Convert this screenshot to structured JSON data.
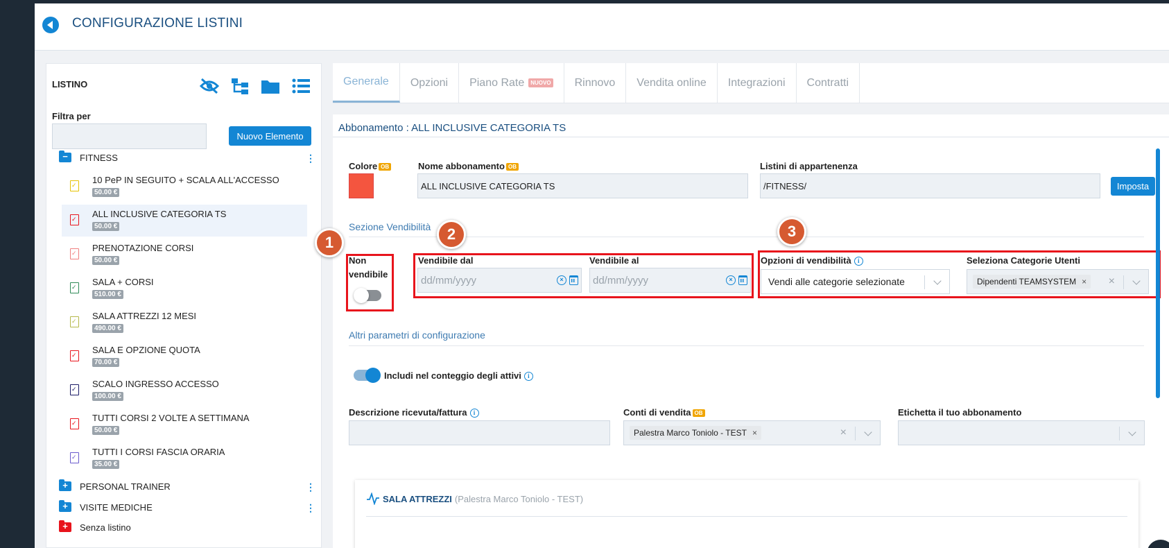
{
  "header": {
    "title": "CONFIGURAZIONE LISTINI"
  },
  "listino": {
    "title": "LISTINO",
    "filter_label": "Filtra per",
    "filter_value": "",
    "new_button": "Nuovo Elemento",
    "groups": [
      {
        "name": "FITNESS",
        "color": "#1386d4",
        "symbol": "−"
      },
      {
        "name": "PERSONAL TRAINER",
        "color": "#1386d4",
        "symbol": "+"
      },
      {
        "name": "VISITE MEDICHE",
        "color": "#1386d4",
        "symbol": "+"
      },
      {
        "name": "Senza listino",
        "color": "#e8141c",
        "symbol": "+"
      }
    ],
    "items": [
      {
        "label": "10 PeP IN SEGUITO + SCALA ALL'ACCESSO",
        "price": "50.00 €",
        "icon_color": "#e6c200"
      },
      {
        "label": "ALL INCLUSIVE CATEGORIA TS",
        "price": "50.00 €",
        "icon_color": "#e8141c"
      },
      {
        "label": "PRENOTAZIONE CORSI",
        "price": "50.00 €",
        "icon_color": "#f08080"
      },
      {
        "label": "SALA + CORSI",
        "price": "510.00 €",
        "icon_color": "#2e8b57"
      },
      {
        "label": "SALA ATTREZZI 12 MESI",
        "price": "490.00 €",
        "icon_color": "#b5b84a"
      },
      {
        "label": "SALA E OPZIONE QUOTA",
        "price": "70.00 €",
        "icon_color": "#e8141c"
      },
      {
        "label": "SCALO INGRESSO ACCESSO",
        "price": "100.00 €",
        "icon_color": "#1a1a66"
      },
      {
        "label": "TUTTI CORSI 2 VOLTE A SETTIMANA",
        "price": "50.00 €",
        "icon_color": "#e8141c"
      },
      {
        "label": "TUTTI I CORSI FASCIA ORARIA",
        "price": "35.00 €",
        "icon_color": "#6a5acd"
      }
    ],
    "selected_item": 1
  },
  "tabs": [
    {
      "label": "Generale"
    },
    {
      "label": "Opzioni"
    },
    {
      "label": "Piano Rate",
      "badge": "NUOVO"
    },
    {
      "label": "Rinnovo"
    },
    {
      "label": "Vendita online"
    },
    {
      "label": "Integrazioni"
    },
    {
      "label": "Contratti"
    }
  ],
  "form": {
    "subscription_title": "Abbonamento : ALL INCLUSIVE CATEGORIA TS",
    "ob_badge": "OB",
    "color_label": "Colore",
    "color_value": "#f4553f",
    "name_label": "Nome abbonamento",
    "name_value": "ALL INCLUSIVE CATEGORIA TS",
    "listini_label": "Listini di appartenenza",
    "listini_value": "/FITNESS/",
    "imposta_button": "Imposta",
    "section_vendibilita": "Sezione Vendibilità",
    "non_vendibile_label": "Non vendibile",
    "non_vendibile_on": false,
    "vendibile_dal_label": "Vendibile dal",
    "vendibile_al_label": "Vendibile al",
    "date_placeholder": "dd/mm/yyyy",
    "opzioni_label": "Opzioni di vendibilità",
    "opzioni_value": "Vendi alle categorie selezionate",
    "categorie_label": "Seleziona Categorie Utenti",
    "categorie_chip": "Dipendenti TEAMSYSTEM",
    "section_altri": "Altri parametri di configurazione",
    "includi_label": "Includi nel conteggio degli attivi",
    "includi_on": true,
    "descrizione_label": "Descrizione ricevuta/fattura",
    "descrizione_value": "",
    "conti_label": "Conti di vendita",
    "conti_chip": "Palestra Marco Toniolo - TEST",
    "etichetta_label": "Etichetta il tuo abbonamento",
    "card_title": "SALA ATTREZZI",
    "card_subtitle": "(Palestra Marco Toniolo - TEST)"
  },
  "callouts": [
    "1",
    "2",
    "3"
  ],
  "colors": {
    "accent": "#1386d4",
    "title": "#1a4f80",
    "highlight": "#e8141c",
    "callout": "#d65a31"
  }
}
